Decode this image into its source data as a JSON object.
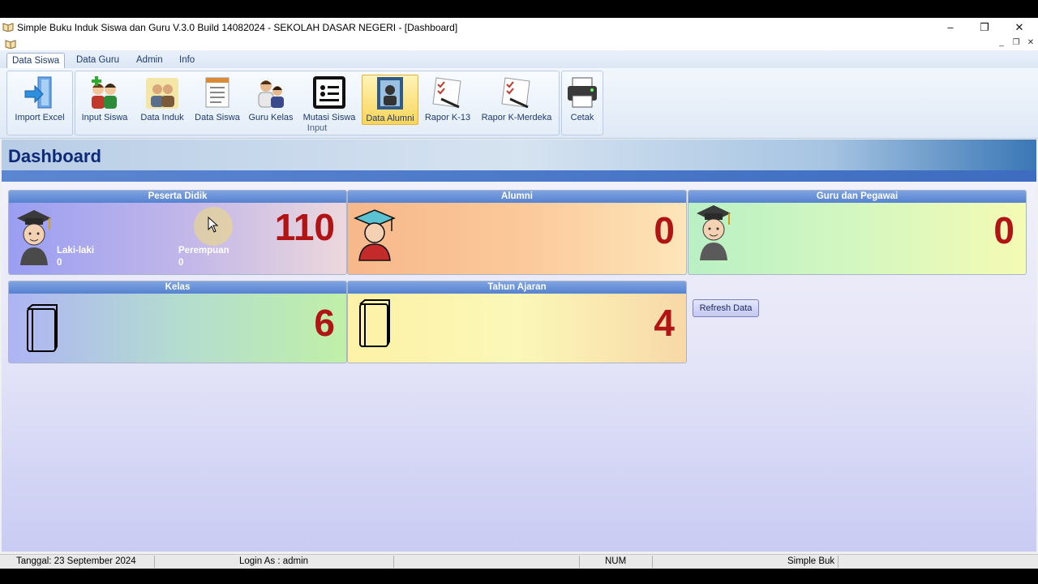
{
  "window": {
    "title": "Simple Buku Induk Siswa dan Guru V.3.0 Build 14082024 - SEKOLAH DASAR NEGERI - [Dashboard]",
    "minimize": "–",
    "restore": "❐",
    "close": "✕",
    "mdi_minimize": "_",
    "mdi_restore": "❐",
    "mdi_close": "✕"
  },
  "menu": {
    "tabs": [
      "Data Siswa",
      "Data Guru",
      "Admin",
      "Info"
    ]
  },
  "ribbon": {
    "import_excel": "Import Excel",
    "input_siswa": "Input Siswa",
    "data_induk": "Data Induk",
    "data_siswa": "Data Siswa",
    "guru_kelas": "Guru Kelas",
    "mutasi_siswa": "Mutasi Siswa",
    "data_alumni": "Data Alumni",
    "rapor_k13": "Rapor K-13",
    "rapor_kmerdeka": "Rapor K-Merdeka",
    "group_input": "Input",
    "cetak": "Cetak"
  },
  "dashboard": {
    "title": "Dashboard",
    "peserta": {
      "header": "Peserta Didik",
      "total": "110",
      "laki_label": "Laki-laki",
      "laki_value": "0",
      "perempuan_label": "Perempuan",
      "perempuan_value": "0"
    },
    "alumni": {
      "header": "Alumni",
      "value": "0"
    },
    "guru": {
      "header": "Guru dan Pegawai",
      "value": "0"
    },
    "kelas": {
      "header": "Kelas",
      "value": "6"
    },
    "tahun": {
      "header": "Tahun Ajaran",
      "value": "4"
    },
    "refresh": "Refresh Data"
  },
  "status": {
    "tanggal": "Tanggal: 23 September 2024",
    "login": "Login As : admin",
    "num": "NUM",
    "app": "Simple Buk"
  }
}
